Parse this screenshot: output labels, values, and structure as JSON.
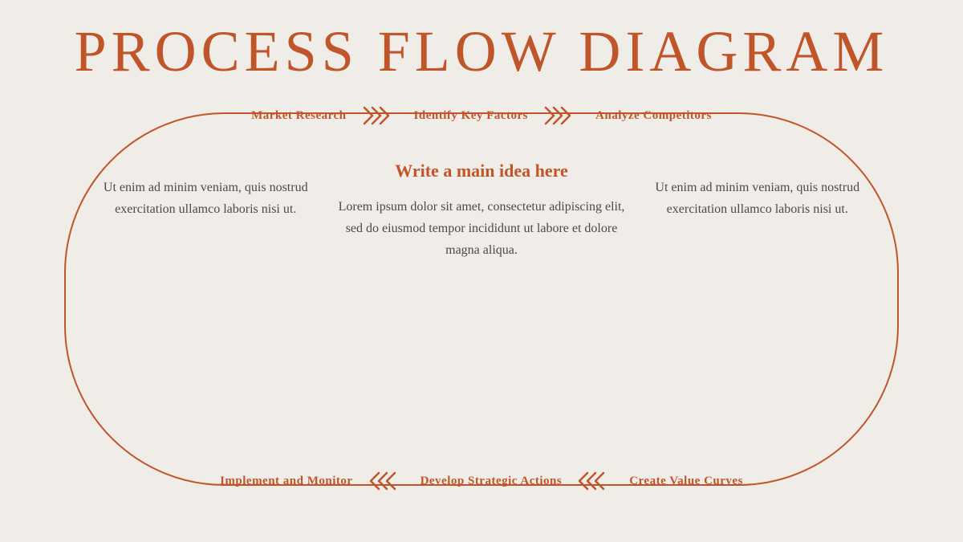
{
  "title": "PROCESS FLOW DIAGRAM",
  "top_flow": {
    "step1": "Market Research",
    "step2": "Identify Key Factors",
    "step3": "Analyze Competitors"
  },
  "bottom_flow": {
    "step1": "Implement and Monitor",
    "step2": "Develop Strategic Actions",
    "step3": "Create Value Curves"
  },
  "center": {
    "main_idea": "Write a main idea here",
    "main_text": "Lorem ipsum dolor sit amet, consectetur adipiscing elit, sed do eiusmod tempor incididunt ut labore et dolore magna aliqua."
  },
  "left_text": "Ut enim ad minim veniam, quis nostrud exercitation ullamco laboris nisi ut.",
  "right_text": "Ut enim ad minim veniam, quis nostrud exercitation ullamco laboris nisi ut.",
  "colors": {
    "accent": "#c0552a",
    "background": "#f0ede8",
    "text": "#4a4a4a"
  }
}
